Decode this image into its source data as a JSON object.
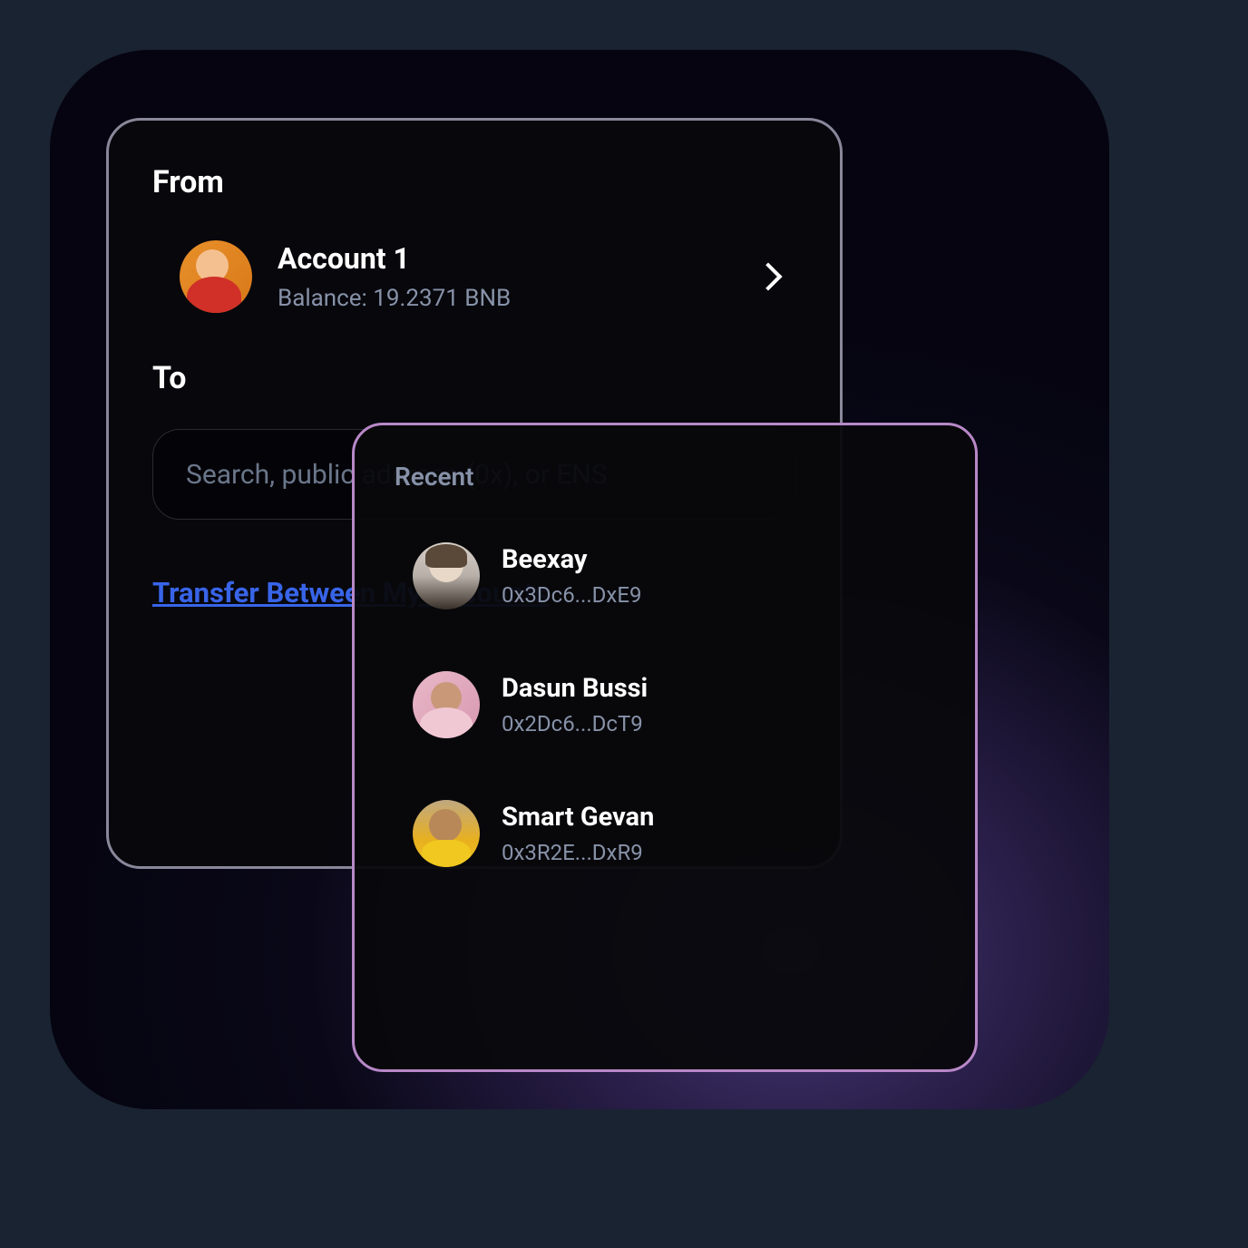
{
  "from": {
    "label": "From",
    "account": {
      "name": "Account 1",
      "balance": "Balance: 19.2371 BNB"
    }
  },
  "to": {
    "label": "To",
    "search_placeholder": "Search, public address (0x), or ENS"
  },
  "transfer_link": "Transfer Between My Accounts",
  "recent": {
    "title": "Recent",
    "items": [
      {
        "name": "Beexay",
        "address": "0x3Dc6...DxE9"
      },
      {
        "name": "Dasun Bussi",
        "address": "0x2Dc6...DcT9"
      },
      {
        "name": "Smart Gevan",
        "address": "0x3R2E...DxR9"
      }
    ]
  }
}
